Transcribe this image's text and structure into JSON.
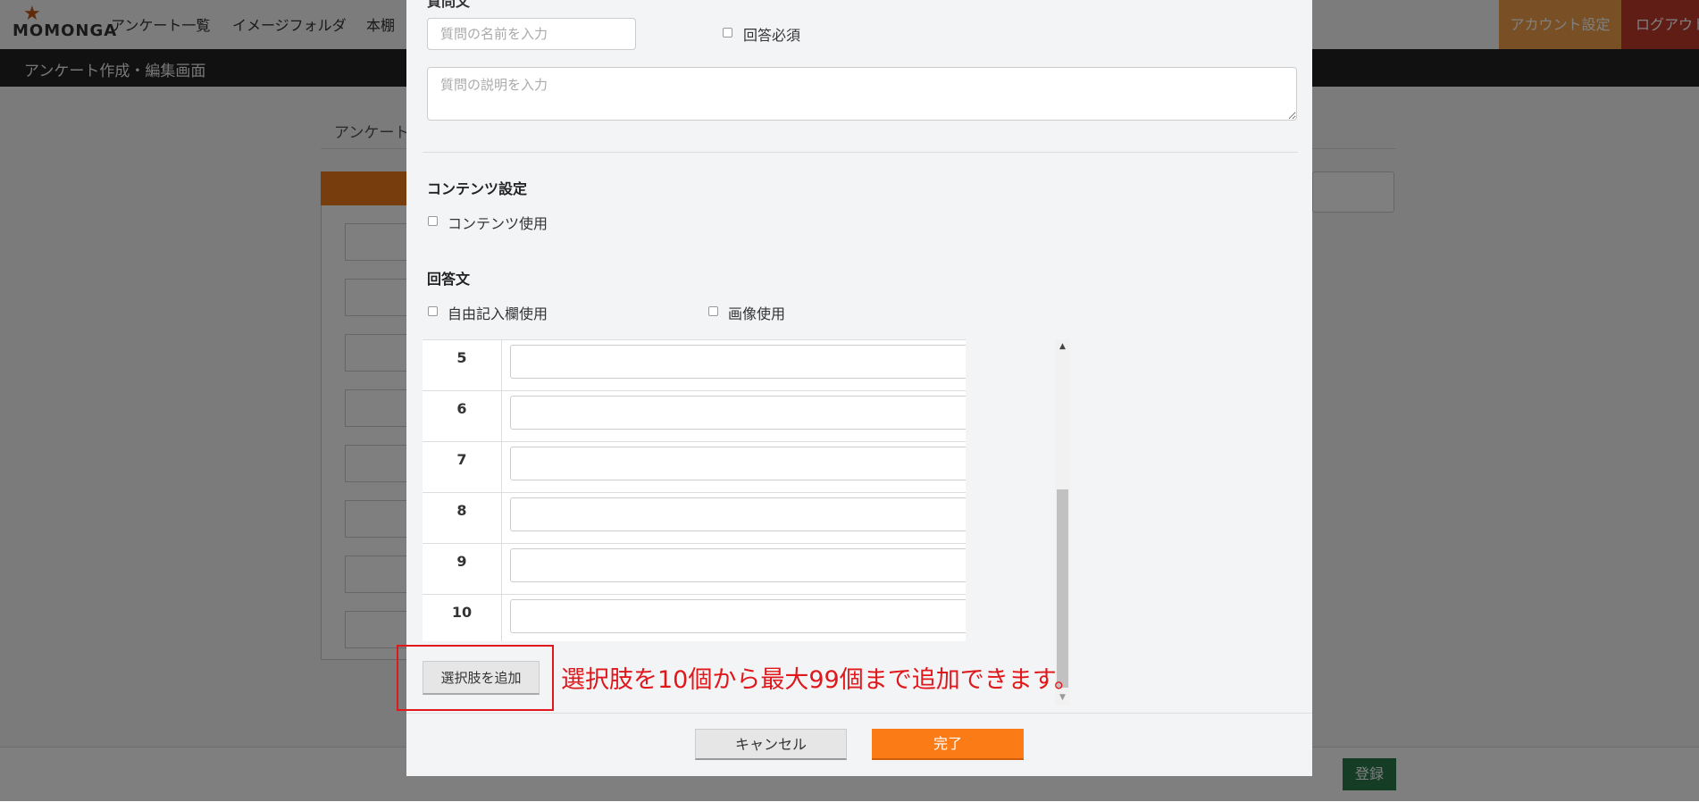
{
  "app": {
    "logo_text": "MOMONGA",
    "nav": [
      "アンケート一覧",
      "イメージフォルダ",
      "本棚"
    ],
    "account_settings": "アカウント設定",
    "logout": "ログアウト"
  },
  "subbar": {
    "title": "アンケート作成・編集画面"
  },
  "background": {
    "tab_label": "アンケート",
    "register_button": "登録"
  },
  "modal": {
    "question_section_label": "質問文",
    "question_name_placeholder": "質問の名前を入力",
    "required_label": "回答必須",
    "question_desc_placeholder": "質問の説明を入力",
    "contents_section_title": "コンテンツ設定",
    "contents_use_label": "コンテンツ使用",
    "answer_section_title": "回答文",
    "free_text_label": "自由記入欄使用",
    "image_use_label": "画像使用",
    "choices": [
      {
        "num": "5",
        "value": ""
      },
      {
        "num": "6",
        "value": ""
      },
      {
        "num": "7",
        "value": ""
      },
      {
        "num": "8",
        "value": ""
      },
      {
        "num": "9",
        "value": ""
      },
      {
        "num": "10",
        "value": ""
      }
    ],
    "add_choice_button": "選択肢を追加",
    "annotation": "選択肢を10個から最大99個まで追加できます。",
    "cancel_button": "キャンセル",
    "done_button": "完了"
  },
  "colors": {
    "accent_orange": "#fb7c17",
    "annotation_red": "#e0171b",
    "logout_red": "#c13a2c",
    "register_green": "#2a7a4a"
  }
}
